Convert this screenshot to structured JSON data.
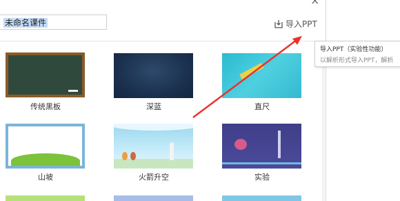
{
  "dialog": {
    "minimize_glyph": "‒",
    "close_glyph": "×",
    "name_input_value": "未命名课件",
    "import_button_label": "导入PPT"
  },
  "templates": [
    {
      "name": "传统黑板"
    },
    {
      "name": "深蓝"
    },
    {
      "name": "直尺"
    },
    {
      "name": "山坡"
    },
    {
      "name": "火箭升空"
    },
    {
      "name": "实验"
    }
  ],
  "tooltip": {
    "title": "导入PPT（实验性功能）",
    "description": "以解析形式导入PPT，解析"
  },
  "colors": {
    "arrow": "#e8332f",
    "accent": "#c4dcf7"
  },
  "icons": {
    "import": "import-icon"
  }
}
